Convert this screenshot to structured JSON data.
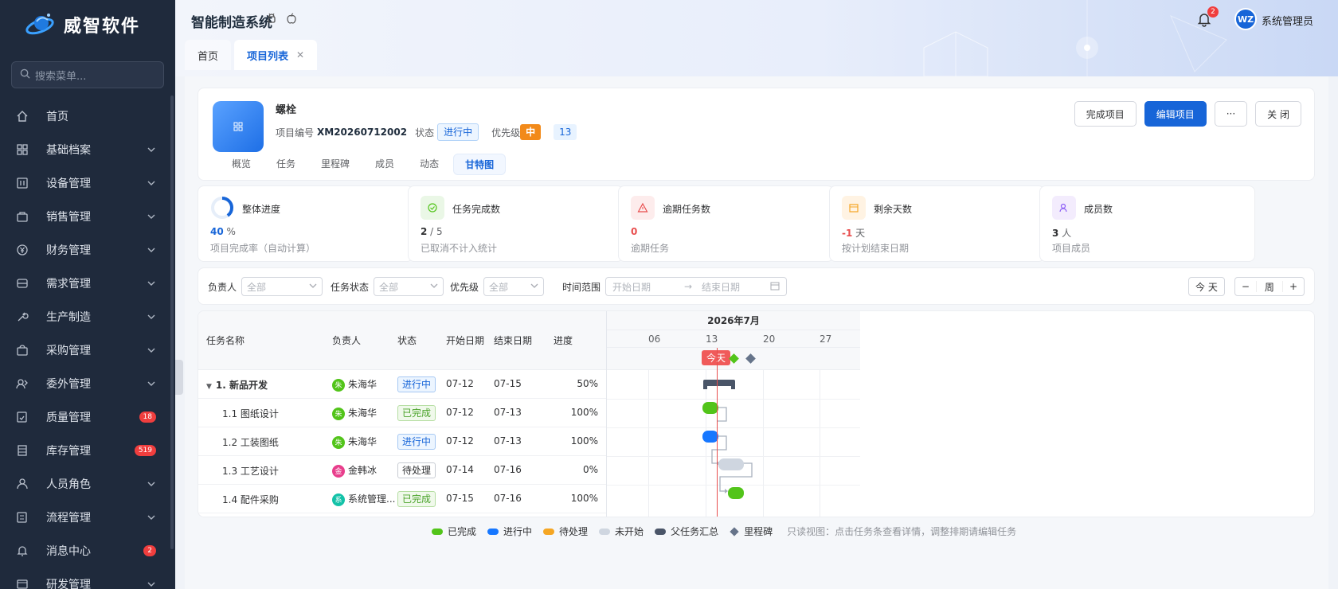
{
  "brand": {
    "name": "威智软件"
  },
  "sidebar": {
    "search_placeholder": "搜索菜单...",
    "items": [
      {
        "label": "首页",
        "icon": "home-icon"
      },
      {
        "label": "基础档案",
        "icon": "grid-icon"
      },
      {
        "label": "设备管理",
        "icon": "device-icon"
      },
      {
        "label": "销售管理",
        "icon": "bag-icon"
      },
      {
        "label": "财务管理",
        "icon": "yen-icon"
      },
      {
        "label": "需求管理",
        "icon": "inbox-icon"
      },
      {
        "label": "生产制造",
        "icon": "wrench-icon"
      },
      {
        "label": "采购管理",
        "icon": "cart-icon"
      },
      {
        "label": "委外管理",
        "icon": "outsource-icon"
      },
      {
        "label": "质量管理",
        "icon": "quality-icon",
        "badge": "18"
      },
      {
        "label": "库存管理",
        "icon": "storage-icon",
        "badge": "519"
      },
      {
        "label": "人员角色",
        "icon": "user-icon"
      },
      {
        "label": "流程管理",
        "icon": "flow-icon"
      },
      {
        "label": "消息中心",
        "icon": "bell-icon",
        "badge": "2"
      },
      {
        "label": "研发管理",
        "icon": "rd-icon"
      }
    ]
  },
  "header": {
    "system_title": "智能制造系统",
    "notification_count": "2",
    "avatar_initials": "WZ",
    "user_name": "系统管理员",
    "tabs": [
      {
        "label": "首页"
      },
      {
        "label": "项目列表"
      }
    ]
  },
  "project": {
    "name": "螺栓",
    "code_label": "项目编号",
    "code": "XM20260712002",
    "status_label": "状态",
    "status": "进行中",
    "priority_label": "优先级",
    "priority": "中",
    "extra": "13",
    "tabs": [
      "概览",
      "任务",
      "里程碑",
      "成员",
      "动态",
      "甘特图"
    ],
    "buttons": {
      "complete": "完成项目",
      "edit": "编辑项目",
      "more": "···",
      "close": "关 闭"
    }
  },
  "stats": [
    {
      "title": "整体进度",
      "value": "40",
      "unit": "%",
      "sub": "项目完成率（自动计算）",
      "color": "#1765d8",
      "progress": 0.4
    },
    {
      "title": "任务完成数",
      "value": "2",
      "unit": "/ 5",
      "sub": "已取消不计入统计",
      "color": "#303133"
    },
    {
      "title": "逾期任务数",
      "value": "0",
      "unit": "",
      "sub": "逾期任务",
      "color": "#e84d4d"
    },
    {
      "title": "剩余天数",
      "value": "-1",
      "unit": "天",
      "sub": "按计划结束日期",
      "color": "#e84d4d"
    },
    {
      "title": "成员数",
      "value": "3",
      "unit": "人",
      "sub": "项目成员",
      "color": "#303133"
    }
  ],
  "filters": {
    "owner_label": "负责人",
    "owner_value": "全部",
    "status_label": "任务状态",
    "status_value": "全部",
    "priority_label": "优先级",
    "priority_value": "全部",
    "range_label": "时间范围",
    "start_placeholder": "开始日期",
    "arrow": "→",
    "end_placeholder": "结束日期",
    "today_btn": "今 天",
    "minus": "−",
    "scale": "周",
    "plus": "+"
  },
  "gantt": {
    "columns": [
      "任务名称",
      "负责人",
      "状态",
      "开始日期",
      "结束日期",
      "进度"
    ],
    "month": "2026年7月",
    "weeks": [
      "06",
      "13",
      "20",
      "27"
    ],
    "today_label": "今天",
    "rows": [
      {
        "name": "1. 新品开发",
        "owner": "朱海华",
        "owner_initial": "朱",
        "owner_color": "#52c41a",
        "status": "进行中",
        "status_type": "blue",
        "start": "07-12",
        "end": "07-15",
        "progress": "50%",
        "parent": true
      },
      {
        "name": "1.1 图纸设计",
        "owner": "朱海华",
        "owner_initial": "朱",
        "owner_color": "#52c41a",
        "status": "已完成",
        "status_type": "green",
        "start": "07-12",
        "end": "07-13",
        "progress": "100%"
      },
      {
        "name": "1.2 工装图纸",
        "owner": "朱海华",
        "owner_initial": "朱",
        "owner_color": "#52c41a",
        "status": "进行中",
        "status_type": "blue",
        "start": "07-12",
        "end": "07-13",
        "progress": "100%"
      },
      {
        "name": "1.3 工艺设计",
        "owner": "金韩冰",
        "owner_initial": "金",
        "owner_color": "#e83e8c",
        "status": "待处理",
        "status_type": "gray",
        "start": "07-14",
        "end": "07-16",
        "progress": "0%"
      },
      {
        "name": "1.4 配件采购",
        "owner": "系统管理...",
        "owner_initial": "系",
        "owner_color": "#13c2a8",
        "status": "已完成",
        "status_type": "green",
        "start": "07-15",
        "end": "07-16",
        "progress": "100%"
      }
    ]
  },
  "legend": {
    "items": [
      {
        "label": "已完成",
        "color": "#52c41a"
      },
      {
        "label": "进行中",
        "color": "#1677ff"
      },
      {
        "label": "待处理",
        "color": "#f5a623"
      },
      {
        "label": "未开始",
        "color": "#cfd6e0"
      },
      {
        "label": "父任务汇总",
        "color": "#4a5568"
      },
      {
        "label": "里程碑",
        "color": "#66748a"
      }
    ],
    "note": "只读视图：点击任务条查看详情，调整排期请编辑任务"
  }
}
